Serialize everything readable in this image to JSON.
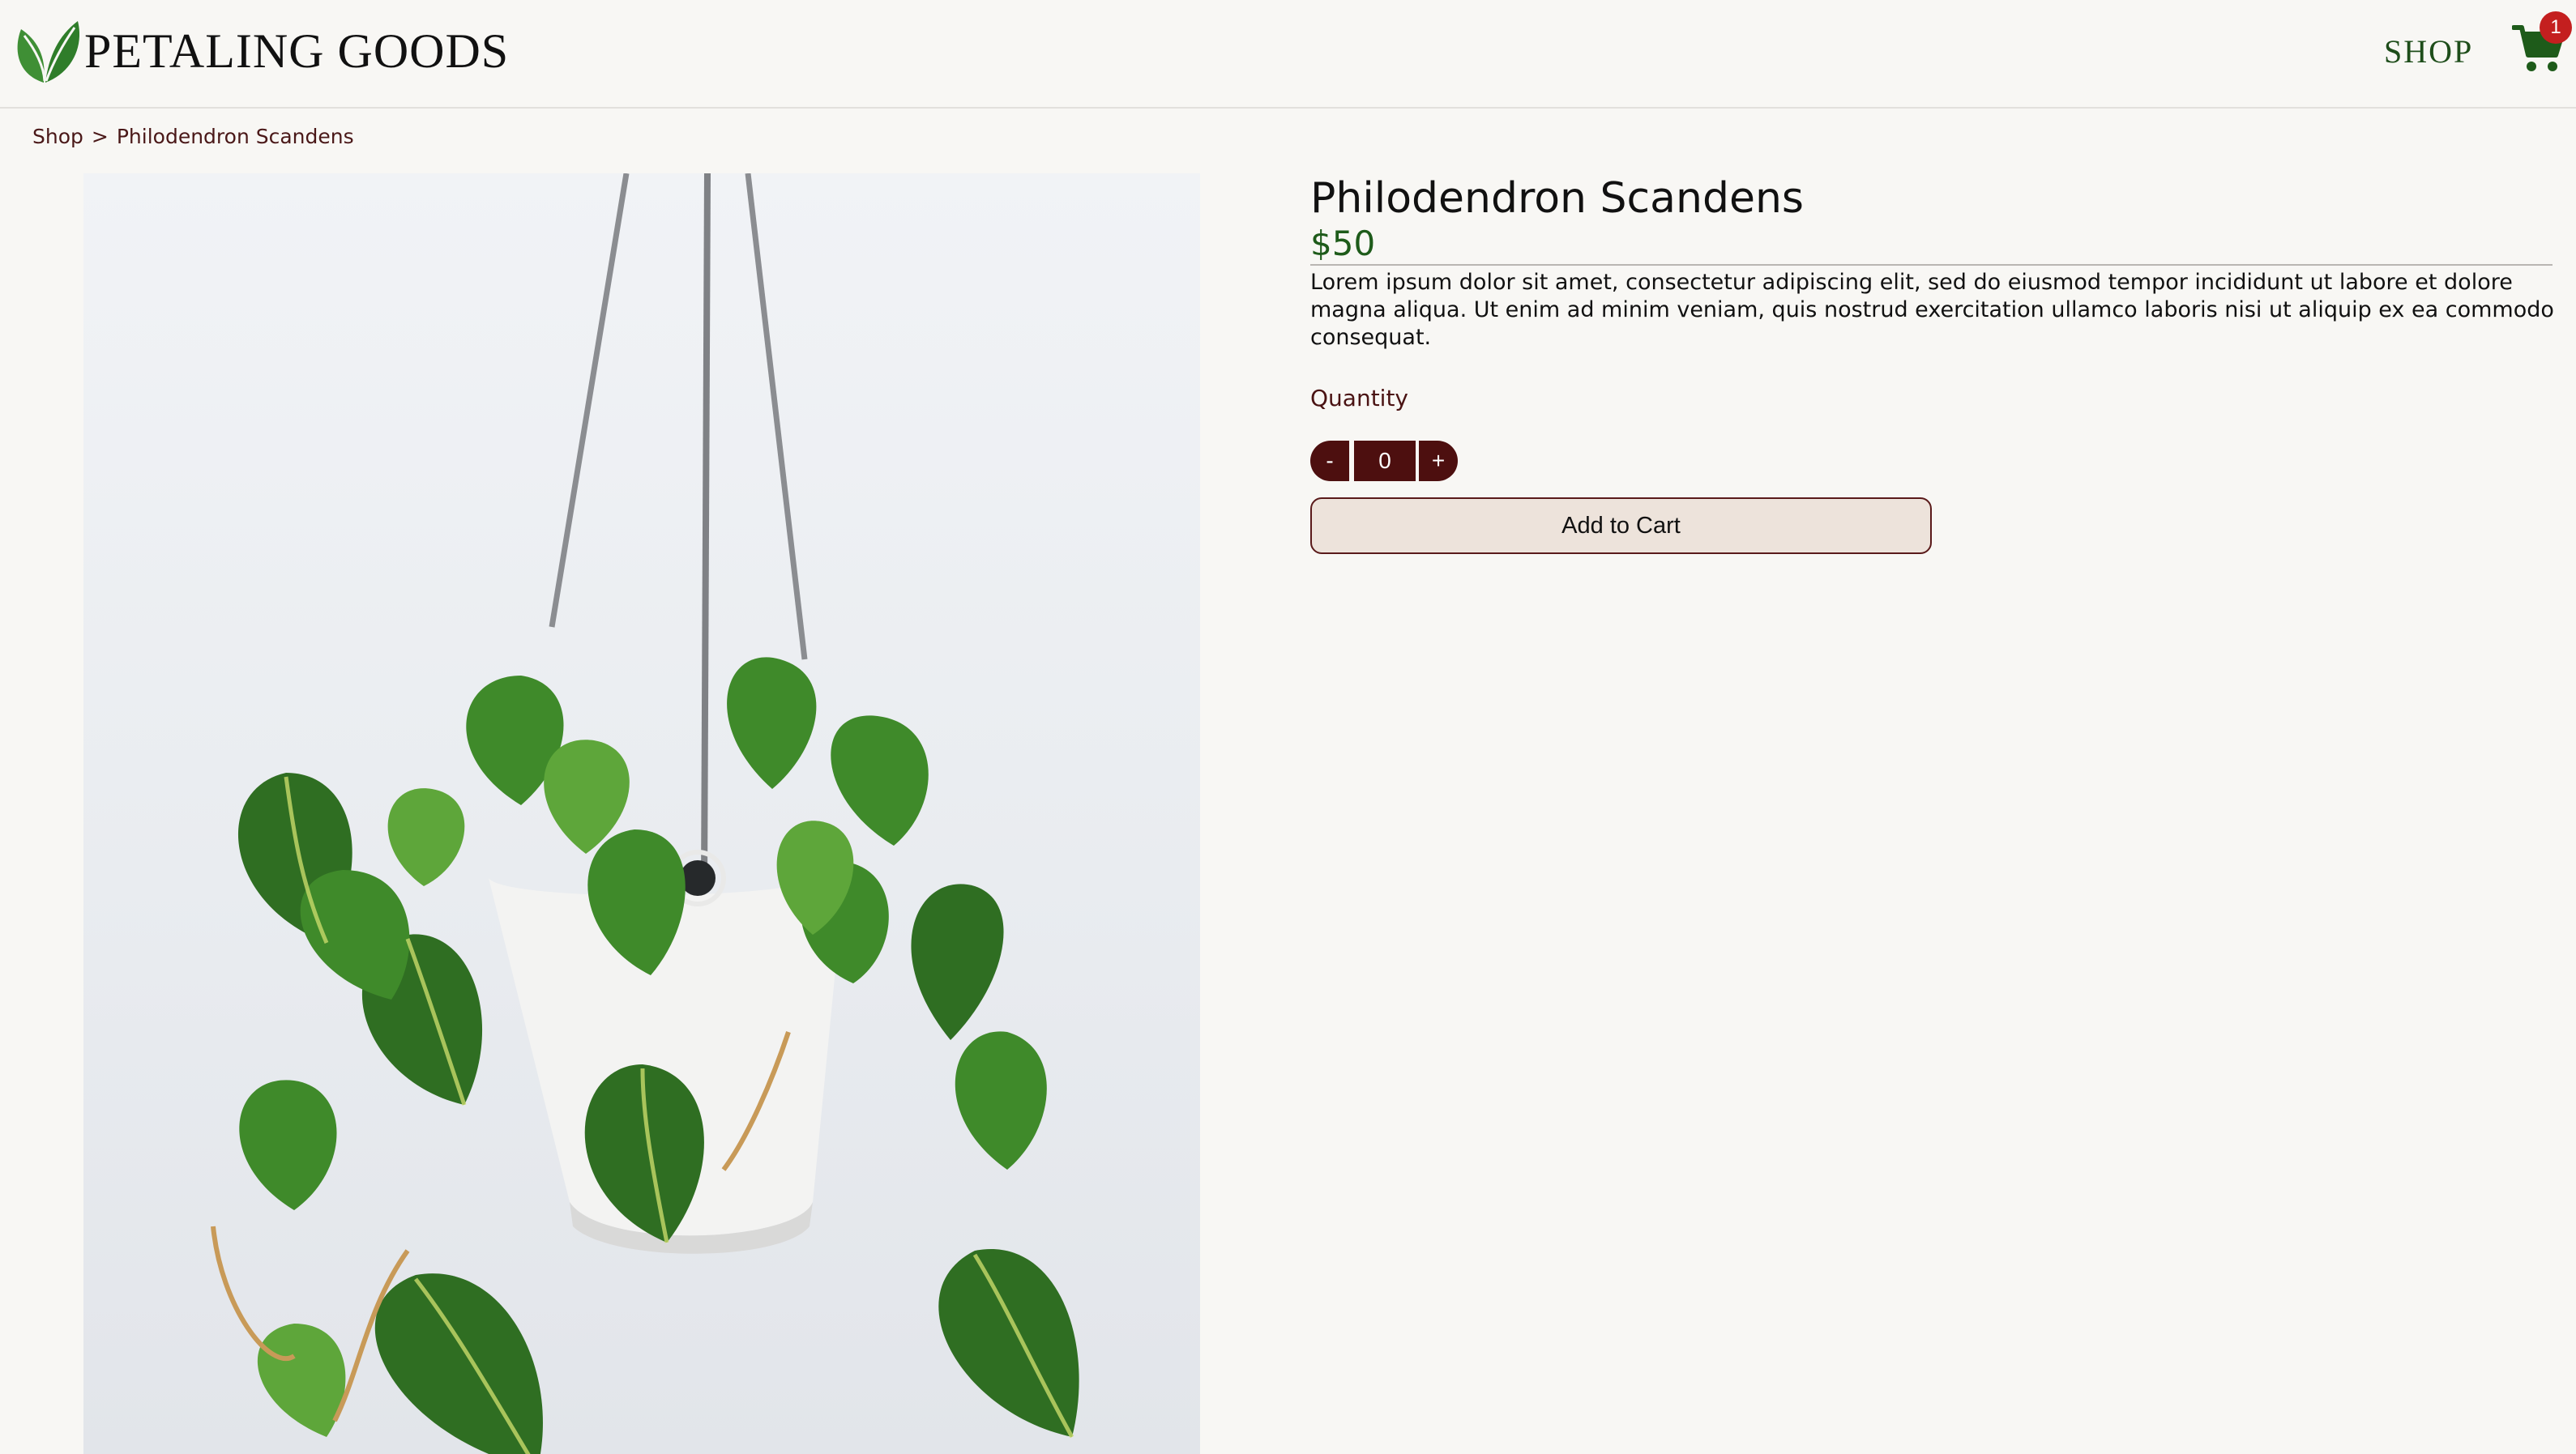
{
  "header": {
    "brand": "PETALING GOODS",
    "nav_shop": "SHOP",
    "cart_count": "1",
    "logo_icon": "leaf-icon",
    "cart_icon": "shopping-cart-icon"
  },
  "breadcrumb": {
    "items": [
      "Shop",
      "Philodendron Scandens"
    ],
    "separator": ">"
  },
  "product": {
    "title": "Philodendron Scandens",
    "price": "$50",
    "description": "Lorem ipsum dolor sit amet, consectetur adipiscing elit, sed do eiusmod tempor incididunt ut labore et dolore magna aliqua. Ut enim ad minim veniam, quis nostrud exercitation ullamco laboris nisi ut aliquip ex ea commodo consequat.",
    "quantity_label": "Quantity",
    "quantity": {
      "decrement": "-",
      "value": "0",
      "increment": "+"
    },
    "add_to_cart": "Add to Cart"
  },
  "colors": {
    "background": "#f8f7f4",
    "accent_green": "#1e5b1a",
    "accent_maroon": "#4d0f0f",
    "badge_red": "#c41f1f",
    "button_bg": "#ede3db"
  }
}
